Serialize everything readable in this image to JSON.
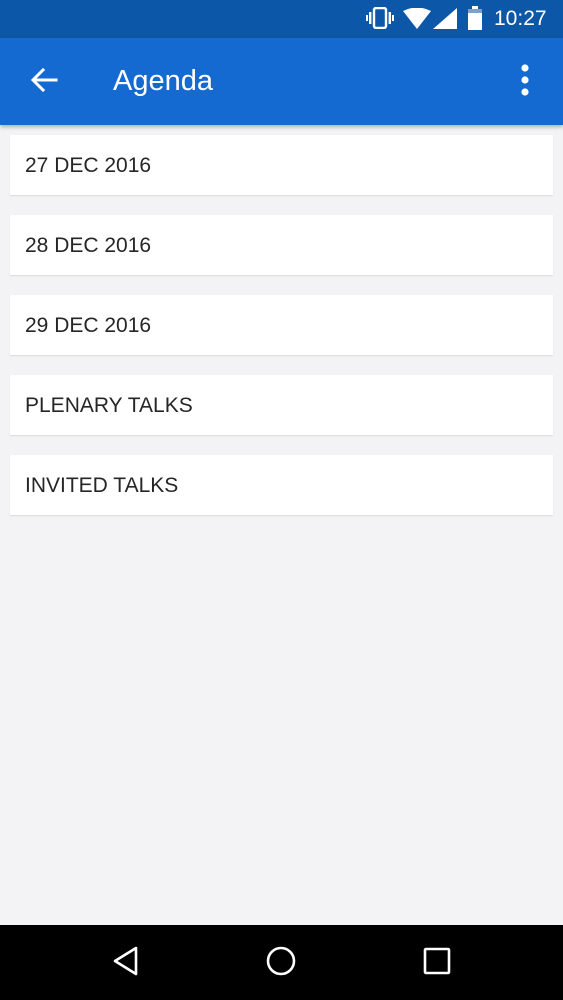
{
  "status_bar": {
    "time": "10:27",
    "icons": [
      "vibrate-icon",
      "wifi-icon",
      "cell-signal-icon",
      "battery-icon"
    ],
    "background": "#0c57a7"
  },
  "app_bar": {
    "title": "Agenda",
    "back_icon": "arrow-back-icon",
    "menu_icon": "more-vert-icon",
    "background": "#146ad1"
  },
  "agenda": {
    "items": [
      {
        "label": "27 DEC 2016"
      },
      {
        "label": "28 DEC 2016"
      },
      {
        "label": "29 DEC 2016"
      },
      {
        "label": "PLENARY TALKS"
      },
      {
        "label": "INVITED TALKS"
      }
    ]
  },
  "nav_bar": {
    "buttons": [
      "nav-back-icon",
      "nav-home-icon",
      "nav-recents-icon"
    ]
  }
}
